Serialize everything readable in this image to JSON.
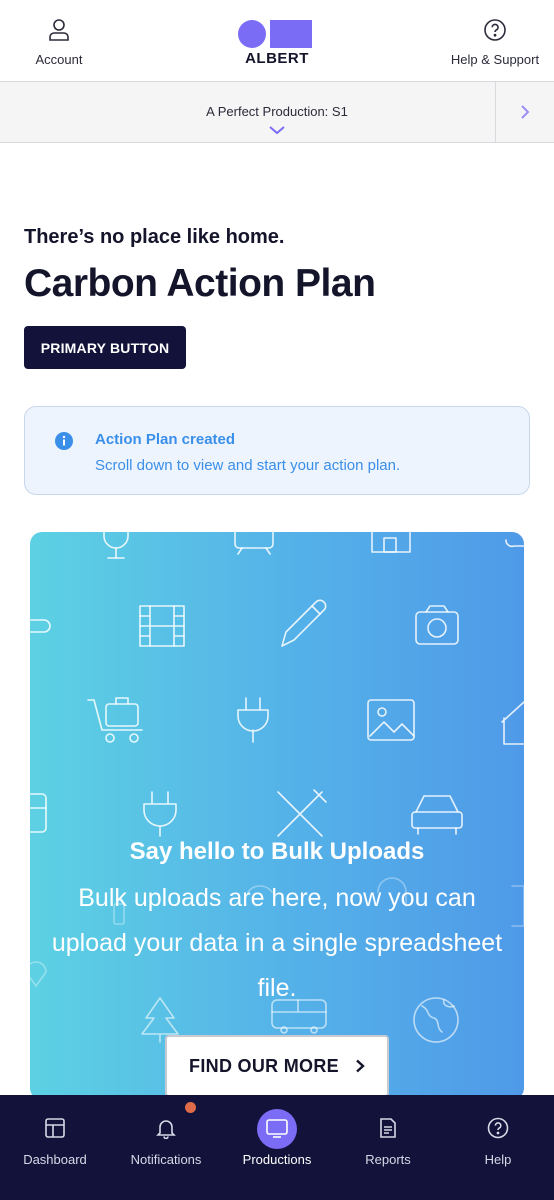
{
  "header": {
    "account_label": "Account",
    "logo_text": "ALBERT",
    "help_label": "Help & Support"
  },
  "production": {
    "name": "A Perfect Production: S1"
  },
  "main": {
    "kicker": "There’s no place like home.",
    "title": "Carbon Action Plan",
    "primary_button": "PRIMARY BUTTON"
  },
  "alert": {
    "title": "Action Plan created",
    "body": "Scroll down to view and start your action plan."
  },
  "promo": {
    "title": "Say hello to Bulk Uploads",
    "body": "Bulk uploads are here, now you can upload your data in a single spreadsheet file.",
    "button": "FIND OUR MORE"
  },
  "nav": {
    "items": [
      {
        "label": "Dashboard",
        "icon": "dashboard-icon"
      },
      {
        "label": "Notifications",
        "icon": "bell-icon"
      },
      {
        "label": "Productions",
        "icon": "monitor-icon",
        "active": true
      },
      {
        "label": "Reports",
        "icon": "report-icon"
      },
      {
        "label": "Help",
        "icon": "help-icon"
      }
    ]
  },
  "colors": {
    "brand": "#7b6cf6",
    "navy": "#12123a",
    "info": "#3a8fe8",
    "notification_dot": "#e06b4a"
  }
}
